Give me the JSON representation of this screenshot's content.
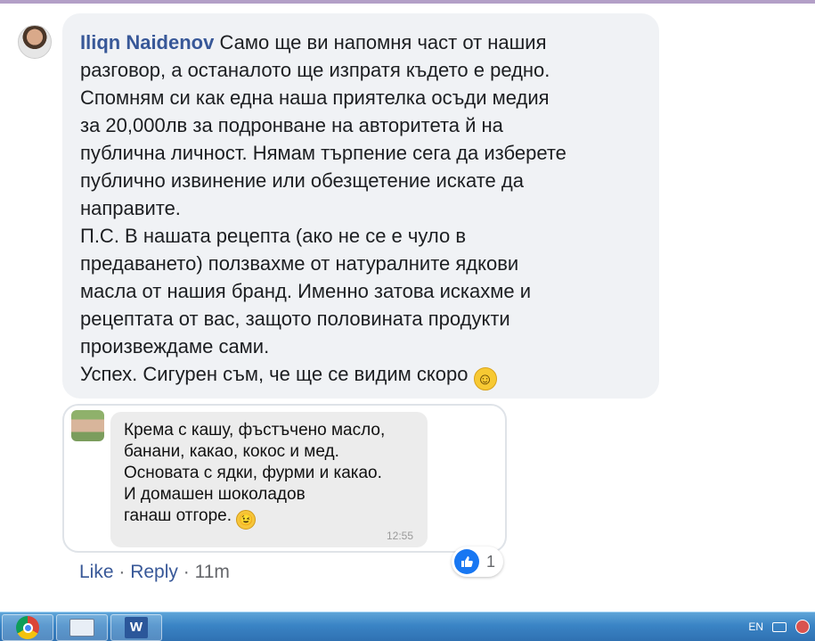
{
  "comment": {
    "author": "Iliqn Naidenov",
    "text": " Само ще ви напомня част от нашия\nразговор, а останалото ще изпратя където е редно.\nСпомням си как една наша приятелка осъди медия\nза 20,000лв за подронване на авторитета й на\nпублична личност. Нямам търпение сега да изберете\nпублично извинение или обезщетение искате да\nнаправите.\nП.С. В нашата рецепта (ако не се е чуло в\nпредаването) ползвахме от натуралните ядкови\nмасла от нашия бранд. Именно затова искахме и\nрецептата от вас, защото половината продукти\nпроизвеждаме сами.\nУспех. Сигурен съм, че ще се видим скоро ",
    "smile_emoji": "☺"
  },
  "attachment": {
    "message": "Крема с кашу, фъстъчено масло,\nбанани, какао, кокос и мед.\nОсновата с ядки, фурми и какао.\nИ домашен шоколадов\nганаш отгоре. ",
    "wink_emoji": "😉",
    "time": "12:55"
  },
  "actions": {
    "like": "Like",
    "reply": "Reply",
    "age": "11m",
    "separator": " · "
  },
  "reactions": {
    "like_icon": "👍",
    "count": "1"
  },
  "taskbar": {
    "word_label": "W",
    "language": "EN"
  },
  "colors": {
    "link": "#385898",
    "bubble": "#f0f2f5",
    "like_blue": "#1877f2"
  }
}
